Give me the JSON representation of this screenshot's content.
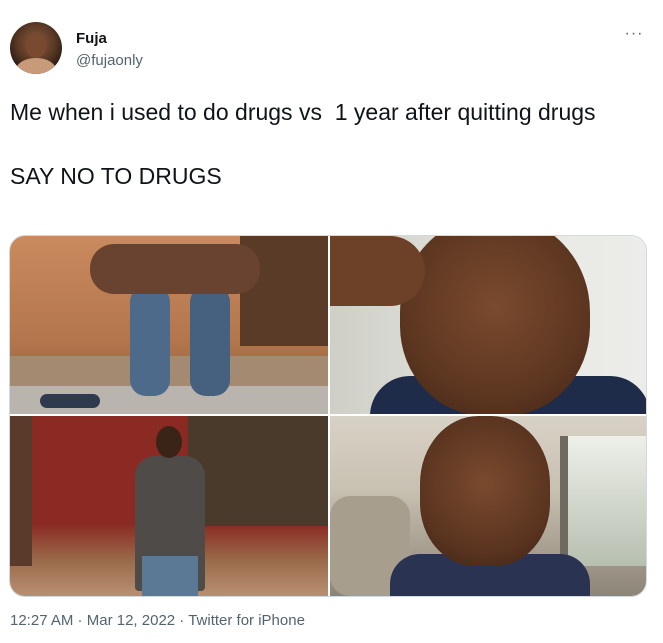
{
  "user": {
    "display_name": "Fuja",
    "handle": "@fujaonly"
  },
  "more_icon": "more-horizontal-icon",
  "more_glyph": "···",
  "tweet": {
    "text": "Me when i used to do drugs vs  1 year after quitting drugs\n\nSAY NO TO DRUGS"
  },
  "media": {
    "count": 4
  },
  "meta": {
    "time": "12:27 AM",
    "separator": " · ",
    "date": "Mar 12, 2022",
    "source": "Twitter for iPhone"
  },
  "colors": {
    "text_primary": "#0f1419",
    "text_secondary": "#536471",
    "border": "#cfd9de"
  }
}
